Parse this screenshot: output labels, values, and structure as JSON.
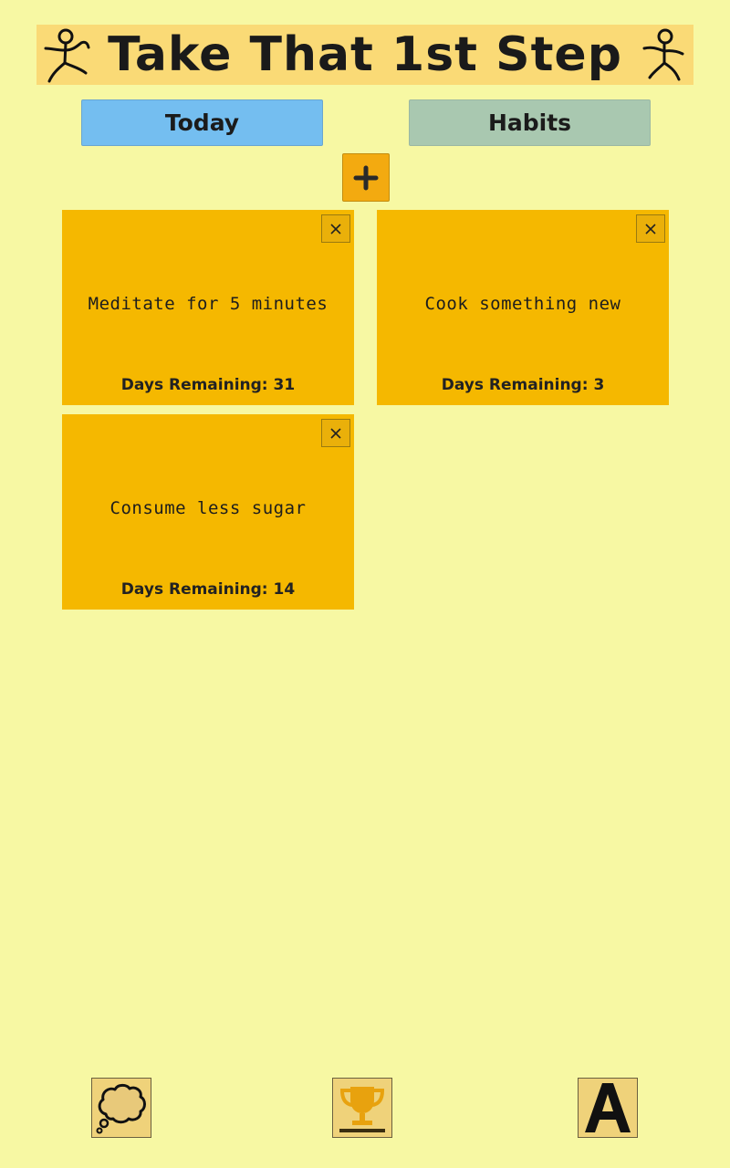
{
  "app": {
    "title": "Take That 1st Step"
  },
  "tabs": {
    "today_label": "Today",
    "habits_label": "Habits"
  },
  "add_button": {
    "icon": "plus-icon"
  },
  "habits": [
    {
      "text": "Meditate for 5 minutes",
      "days_label": "Days Remaining:",
      "days": "31"
    },
    {
      "text": "Cook something new",
      "days_label": "Days Remaining:",
      "days": "3"
    },
    {
      "text": "Consume less sugar",
      "days_label": "Days Remaining:",
      "days": "14"
    }
  ],
  "bottom_nav": {
    "items": [
      {
        "icon": "thought-bubble-icon"
      },
      {
        "icon": "trophy-icon"
      },
      {
        "icon": "letter-a-icon"
      }
    ]
  },
  "colors": {
    "background": "#f7f8a3",
    "header": "#fada76",
    "today_tab": "#74bef0",
    "habits_tab": "#a9c8b0",
    "card": "#f5b800",
    "add_button": "#f3aa10"
  }
}
